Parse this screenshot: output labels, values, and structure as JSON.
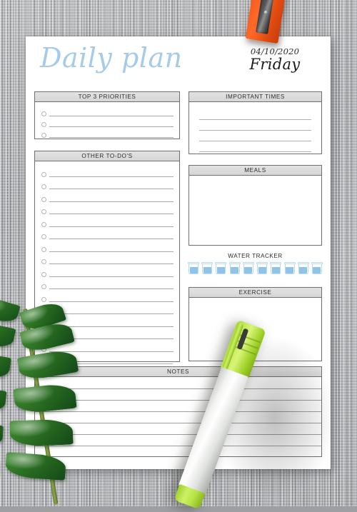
{
  "page": {
    "title": "Daily plan",
    "date": "04/10/2020",
    "weekday": "Friday"
  },
  "sections": {
    "top_priorities": {
      "header": "TOP 3 PRIORITIES",
      "rows": 3,
      "row_type": "checkbox-line"
    },
    "other_todos": {
      "header": "OTHER TO-DO'S",
      "rows": 15,
      "extra_lines": 2,
      "row_type": "checkbox-line"
    },
    "important_times": {
      "header": "IMPORTANT TIMES",
      "rows": 4,
      "row_type": "ruled-line"
    },
    "meals": {
      "header": "MEALS",
      "rows": 0,
      "row_type": "blank"
    },
    "water_tracker": {
      "header": "WATER TRACKER",
      "glasses": 10,
      "glasses_filled": 0,
      "icon": "water-glass-icon"
    },
    "exercise": {
      "header": "EXERCISE",
      "rows": 0,
      "row_type": "blank"
    },
    "notes": {
      "header": "NOTES",
      "rows": 6,
      "row_type": "ruled-line"
    }
  },
  "colors": {
    "title_blue": "#a5cbe8",
    "header_fill": "#dcdcdc",
    "header_border": "#6f6f6f",
    "rule_line": "#a8a8a8",
    "water_fill": "#8fc4e8",
    "water_outline": "#bcdcf2",
    "paper": "#ffffff",
    "background_wood": "#a3a5a8",
    "sharpener_orange": "#f4581c",
    "marker_green": "#a8d930",
    "leaf_green": "#2f7426"
  },
  "decor": {
    "sharpener": "pencil-sharpener-orange",
    "marker": "highlighter-marker-green",
    "plant": "zz-plant-branch"
  }
}
